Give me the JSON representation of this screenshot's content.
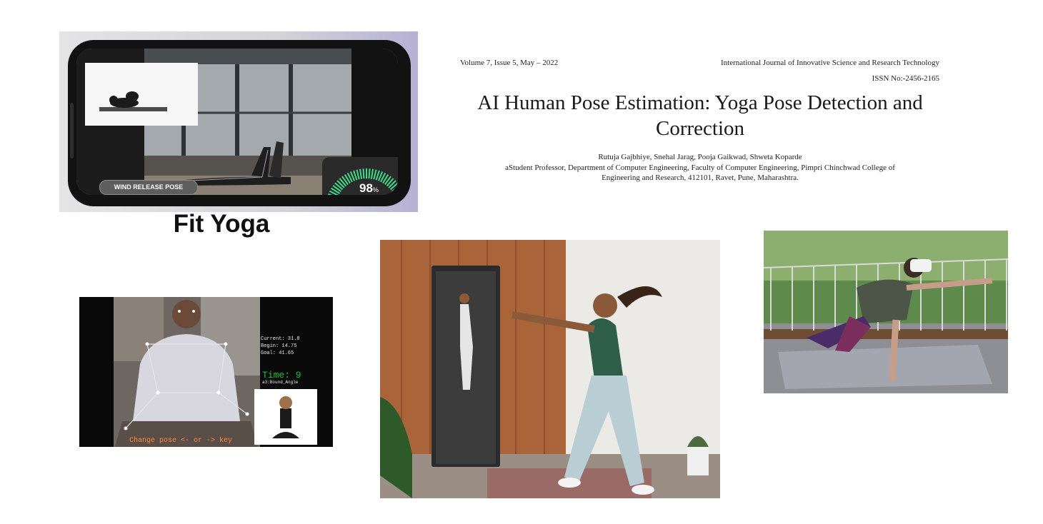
{
  "fit_yoga": {
    "pose_label": "WIND RELEASE POSE",
    "score_value": "98",
    "score_unit": "%",
    "caption": "Fit Yoga"
  },
  "paper": {
    "volume": "Volume 7, Issue 5, May – 2022",
    "journal": "International Journal of Innovative Science and Research Technology",
    "issn": "ISSN No:-2456-2165",
    "title_line1": "AI Human Pose Estimation: Yoga Pose Detection and",
    "title_line2": "Correction",
    "authors": "Rutuja Gajbhiye, Snehal Jarag, Pooja Gaikwad, Shweta Koparde",
    "affiliation_line1": "aStudent Professor, Department of Computer Engineering, Faculty of Computer Engineering, Pimpri Chinchwad College of",
    "affiliation_line2": "Engineering and Research, 412101, Ravet, Pune, Maharashtra."
  },
  "pose_detection": {
    "stat_current": "Current: 31.8",
    "stat_begin": "Begin: 14.75",
    "stat_goal": "Goal: 41.65",
    "time_label": "Time: 9",
    "pose_annotation": "a3:Bound_Angle",
    "change_hint": "Change pose <- or -> key"
  },
  "colors": {
    "gauge_arc": "#3fd98a",
    "time_text": "#19c23a",
    "hint_text": "#ff8a3a"
  }
}
